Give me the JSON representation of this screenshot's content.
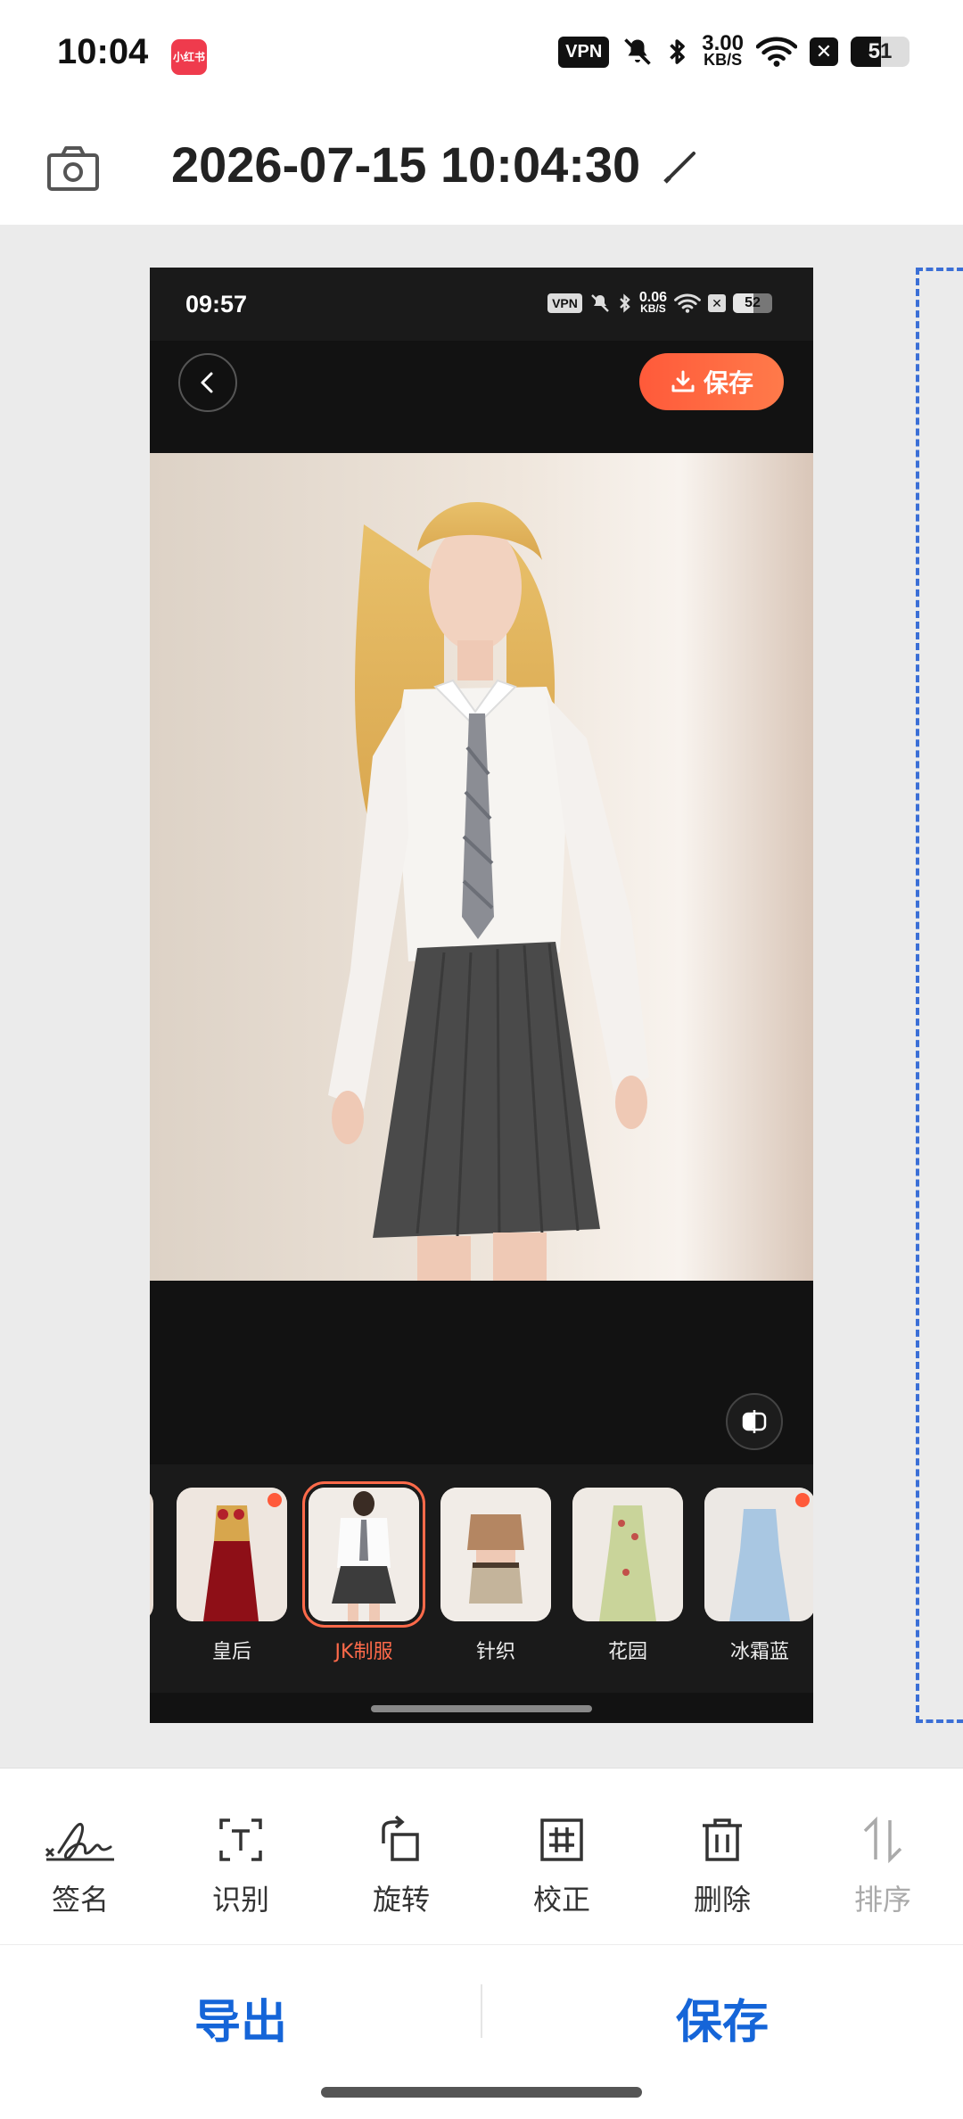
{
  "status_bar": {
    "time": "10:04",
    "app_badge": "小红书",
    "vpn": "VPN",
    "net_speed_value": "3.00",
    "net_speed_unit": "KB/S",
    "battery": "51"
  },
  "header": {
    "title": "2026-07-15 10:04:30"
  },
  "preview": {
    "status": {
      "time": "09:57",
      "vpn": "VPN",
      "net_speed_value": "0.06",
      "net_speed_unit": "KB/S",
      "battery": "52"
    },
    "save_button": "保存",
    "styles": [
      {
        "label": "皇后",
        "hot": true
      },
      {
        "label": "JK制服",
        "selected": true
      },
      {
        "label": "针织"
      },
      {
        "label": "花园"
      },
      {
        "label": "冰霜蓝",
        "hot": true
      }
    ],
    "colors": {
      "accent": "#ff5a3a",
      "background": "#121212"
    }
  },
  "toolbar": {
    "items": [
      {
        "label": "签名",
        "icon": "signature-icon"
      },
      {
        "label": "识别",
        "icon": "text-recognize-icon"
      },
      {
        "label": "旋转",
        "icon": "rotate-icon"
      },
      {
        "label": "校正",
        "icon": "crop-correct-icon"
      },
      {
        "label": "删除",
        "icon": "trash-icon"
      },
      {
        "label": "排序",
        "icon": "sort-icon",
        "disabled": true
      }
    ]
  },
  "actions": {
    "export": "导出",
    "save": "保存"
  },
  "colors": {
    "primary_blue": "#1565d8",
    "canvas_bg": "#ebebeb"
  }
}
